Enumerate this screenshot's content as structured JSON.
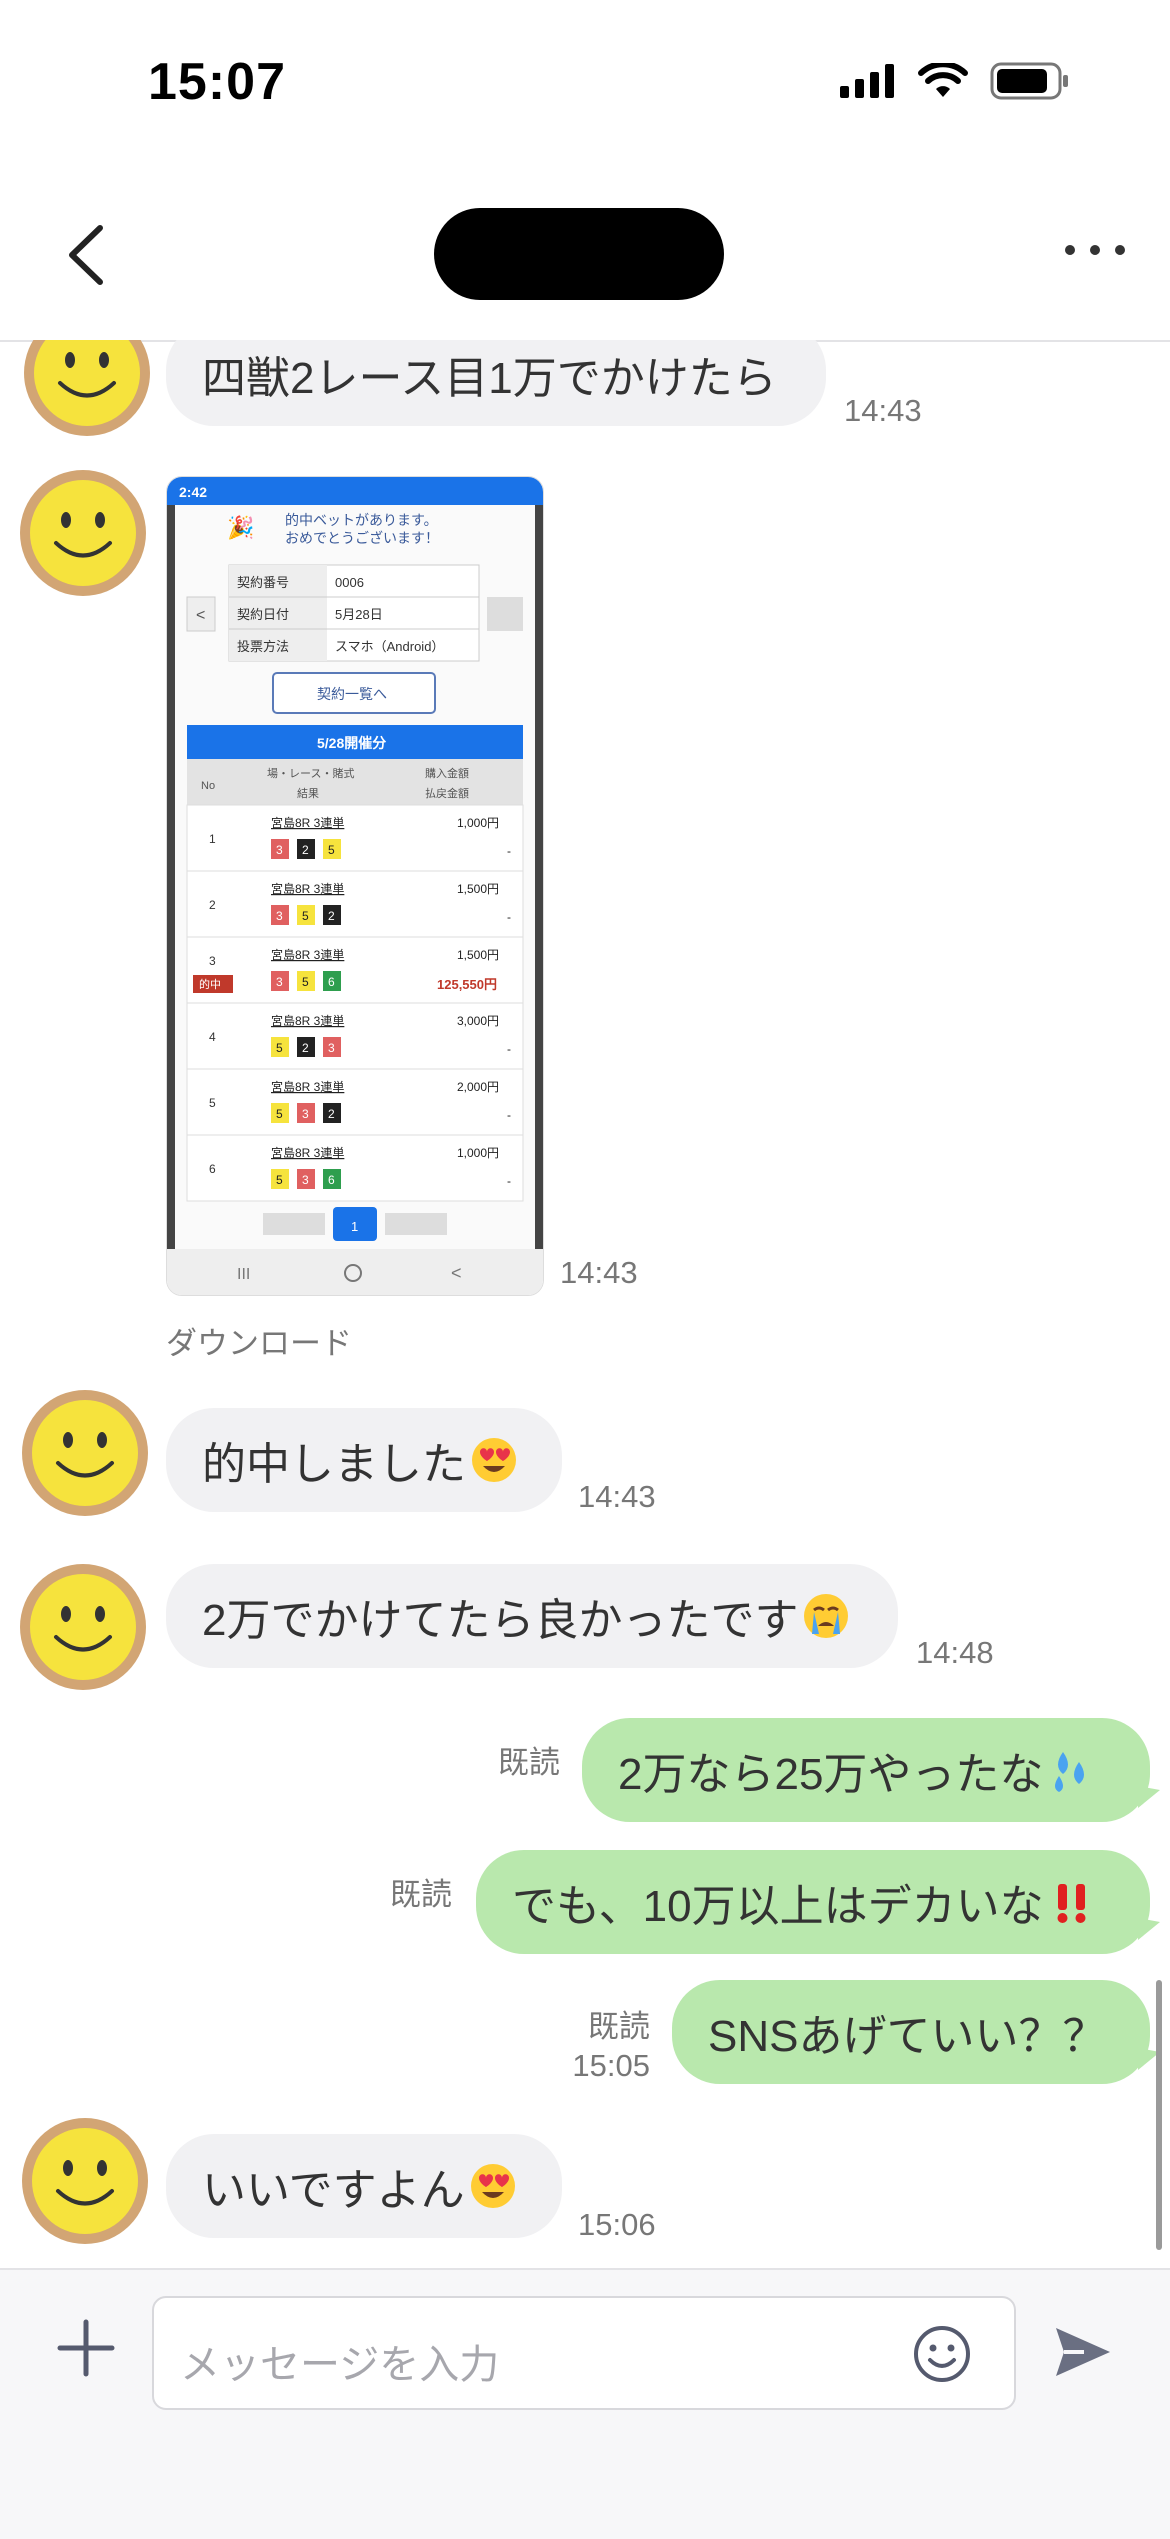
{
  "status_bar": {
    "time": "15:07"
  },
  "header": {
    "back_icon": "chevron-left-icon",
    "more_icon": "ellipsis-icon"
  },
  "messages": [
    {
      "text": "四獣2レース目1万でかけたら",
      "time": "14:43"
    },
    {
      "image": "betting-result-screenshot",
      "time": "14:43",
      "download_label": "ダウンロード"
    },
    {
      "text": "的中しました",
      "emoji": "heart-eyes-emoji",
      "time": "14:43"
    },
    {
      "text": "2万でかけてたら良かったです",
      "emoji": "crying-face-emoji",
      "time": "14:48"
    },
    {
      "text": "2万なら25万やったな",
      "emoji": "sweat-droplets-emoji",
      "read": "既読"
    },
    {
      "text": "でも、10万以上はデカいな",
      "emoji": "double-exclamation-emoji",
      "read": "既読"
    },
    {
      "text": "SNSあげていい？？",
      "read": "既読",
      "time": "15:05"
    },
    {
      "text": "いいですよん",
      "emoji": "heart-eyes-emoji",
      "time": "15:06"
    }
  ],
  "screenshot": {
    "status_time": "2:42",
    "congrats_line1": "的中ベットがあります。",
    "congrats_line2": "おめでとうございます！",
    "contract_rows": [
      {
        "label": "契約番号",
        "value": "0006"
      },
      {
        "label": "契約日付",
        "value": "5月28日"
      },
      {
        "label": "投票方法",
        "value": "スマホ（Android）"
      }
    ],
    "list_button": "契約一覧へ",
    "section_title": "5/28開催分",
    "col_no": "No",
    "col_race": "場・レース・賭式",
    "col_result": "結果",
    "col_amount": "購入金額",
    "col_payout": "払戻金額",
    "bets": [
      {
        "no": "1",
        "race": "宮島8R 3連単",
        "nums": [
          "3",
          "2",
          "5"
        ],
        "amount": "1,000円",
        "payout": "-"
      },
      {
        "no": "2",
        "race": "宮島8R 3連単",
        "nums": [
          "3",
          "5",
          "2"
        ],
        "amount": "1,500円",
        "payout": "-"
      },
      {
        "no": "3",
        "race": "宮島8R 3連単",
        "nums": [
          "3",
          "5",
          "6"
        ],
        "amount": "1,500円",
        "payout": "125,550円",
        "hit": "的中"
      },
      {
        "no": "4",
        "race": "宮島8R 3連単",
        "nums": [
          "5",
          "2",
          "3"
        ],
        "amount": "3,000円",
        "payout": "-"
      },
      {
        "no": "5",
        "race": "宮島8R 3連単",
        "nums": [
          "5",
          "3",
          "2"
        ],
        "amount": "2,000円",
        "payout": "-"
      },
      {
        "no": "6",
        "race": "宮島8R 3連単",
        "nums": [
          "5",
          "3",
          "6"
        ],
        "amount": "1,000円",
        "payout": "-"
      }
    ],
    "page": "1"
  },
  "composer": {
    "placeholder": "メッセージを入力"
  },
  "colors": {
    "my_bubble": "#b9e8ad",
    "their_bubble": "#f1f1f3",
    "accent_blue": "#1a73e8"
  }
}
